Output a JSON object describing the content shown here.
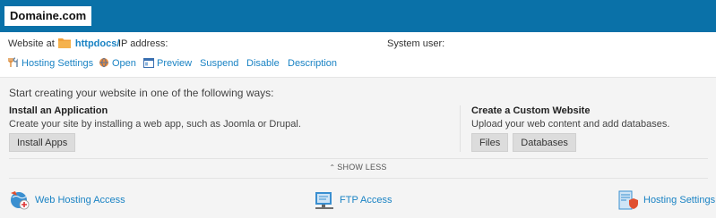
{
  "brand": {
    "logo_text": "Domaine.com",
    "accent": "#0a71a8",
    "link_color": "#1a83c4"
  },
  "website": {
    "label": "Website at",
    "folder": "httpdocs/",
    "ip_label": "IP address:",
    "system_user_label": "System user:"
  },
  "actions": [
    {
      "label": "Hosting Settings",
      "icon": "wrench-fork-icon"
    },
    {
      "label": "Open",
      "icon": "globe-icon"
    },
    {
      "label": "Preview",
      "icon": "preview-icon"
    },
    {
      "label": "Suspend"
    },
    {
      "label": "Disable"
    },
    {
      "label": "Description"
    }
  ],
  "panel": {
    "headline": "Start creating your website in one of the following ways:",
    "install": {
      "title": "Install an Application",
      "desc": "Create your site by installing a web app, such as Joomla or Drupal.",
      "button": "Install Apps"
    },
    "custom": {
      "title": "Create a Custom Website",
      "desc": "Upload your web content and add databases.",
      "buttons": [
        "Files",
        "Databases"
      ]
    },
    "toggle": "SHOW LESS"
  },
  "features": [
    {
      "label": "Web Hosting Access",
      "icon": "web-hosting-access-icon"
    },
    {
      "label": "FTP Access",
      "icon": "ftp-access-icon"
    },
    {
      "label": "Hosting Settings",
      "icon": "hosting-settings-icon"
    }
  ]
}
